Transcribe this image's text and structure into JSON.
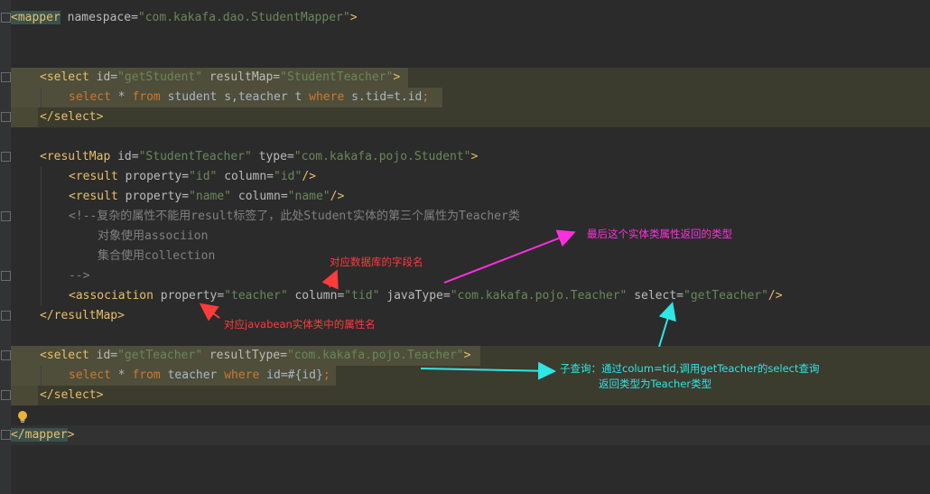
{
  "code": {
    "l1_open": "<mapper",
    "l1_attr": " namespace=",
    "l1_val": "\"com.kakafa.dao.StudentMapper\"",
    "l1_close": ">",
    "sel1_open": "<select",
    "sel1_a1": " id=",
    "sel1_v1": "\"getStudent\"",
    "sel1_a2": " resultMap=",
    "sel1_v2": "\"StudentTeacher\"",
    "sel1_close": ">",
    "sql1_kw1": "select",
    "sql1_t1": " * ",
    "sql1_kw2": "from",
    "sql1_t2": " student s,teacher t ",
    "sql1_kw3": "where",
    "sql1_t3": " s.tid=t.id",
    "sql1_end": ";",
    "sel1_end": "</select>",
    "rm_open": "<resultMap",
    "rm_a1": " id=",
    "rm_v1": "\"StudentTeacher\"",
    "rm_a2": " type=",
    "rm_v2": "\"com.kakafa.pojo.Student\"",
    "rm_close": ">",
    "r1_open": "<result",
    "r1_a1": " property=",
    "r1_v1": "\"id\"",
    "r1_a2": " column=",
    "r1_v2": "\"id\"",
    "r1_close": "/>",
    "r2_open": "<result",
    "r2_a1": " property=",
    "r2_v1": "\"name\"",
    "r2_a2": " column=",
    "r2_v2": "\"name\"",
    "r2_close": "/>",
    "c1": "<!--复杂的属性不能用result标签了，此处Student实体的第三个属性为Teacher类",
    "c2": "对象使用associion",
    "c3": "集合使用collection",
    "c4": "-->",
    "as_open": "<association",
    "as_a1": " property=",
    "as_v1": "\"teacher\"",
    "as_a2": " column=",
    "as_v2": "\"tid\"",
    "as_a3": " javaType=",
    "as_v3": "\"com.kakafa.pojo.Teacher\"",
    "as_a4": " select=",
    "as_v4": "\"getTeacher\"",
    "as_close": "/>",
    "rm_end": "</resultMap>",
    "sel2_open": "<select",
    "sel2_a1": " id=",
    "sel2_v1": "\"getTeacher\"",
    "sel2_a2": " resultType=",
    "sel2_v2": "\"com.kakafa.pojo.Teacher\"",
    "sel2_close": ">",
    "sql2_kw1": "select",
    "sql2_t1": " * ",
    "sql2_kw2": "from",
    "sql2_t2": " teacher ",
    "sql2_kw3": "where",
    "sql2_t3": " id=#{id}",
    "sql2_end": ";",
    "sel2_end": "</select>",
    "mapper_end_lt": "</",
    "mapper_end_name": "mapper",
    "mapper_end_gt": ">"
  },
  "annotations": {
    "return_type": "最后这个实体类属性返回的类型",
    "db_field": "对应数据库的字段名",
    "bean_prop": "对应javabean实体类中的属性名",
    "subquery_1": "子查询：通过colum=tid,调用getTeacher的select查询",
    "subquery_2": "返回类型为Teacher类型"
  },
  "colors": {
    "background": "#2b2b2b",
    "tag": "#e8bf6a",
    "string": "#6a8759",
    "keyword": "#cc7832",
    "comment": "#808080",
    "annotation_magenta": "#ff2fe0",
    "annotation_red": "#ff3b3b",
    "annotation_cyan": "#2ee6e6"
  },
  "icons": {
    "intention_bulb": "lightbulb-icon"
  }
}
